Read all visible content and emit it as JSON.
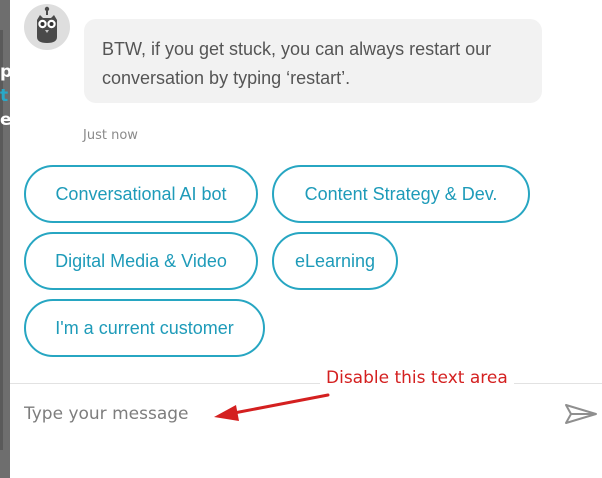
{
  "background_fragments": [
    "p",
    "t",
    "e"
  ],
  "bot": {
    "avatar_icon": "owl-bot-icon",
    "message": "BTW, if you get stuck, you can always restart our conversation by typing ‘restart’.",
    "timestamp": "Just now"
  },
  "quick_replies": [
    "Conversational AI bot",
    "Content Strategy & Dev.",
    "Digital Media & Video",
    "eLearning",
    "I'm a current customer"
  ],
  "composer": {
    "placeholder": "Type your message",
    "send_icon": "send-icon"
  },
  "annotation": {
    "text": "Disable this text area",
    "color": "#d42020"
  },
  "colors": {
    "accent": "#27a6c2",
    "bubble_bg": "#f2f2f2"
  }
}
